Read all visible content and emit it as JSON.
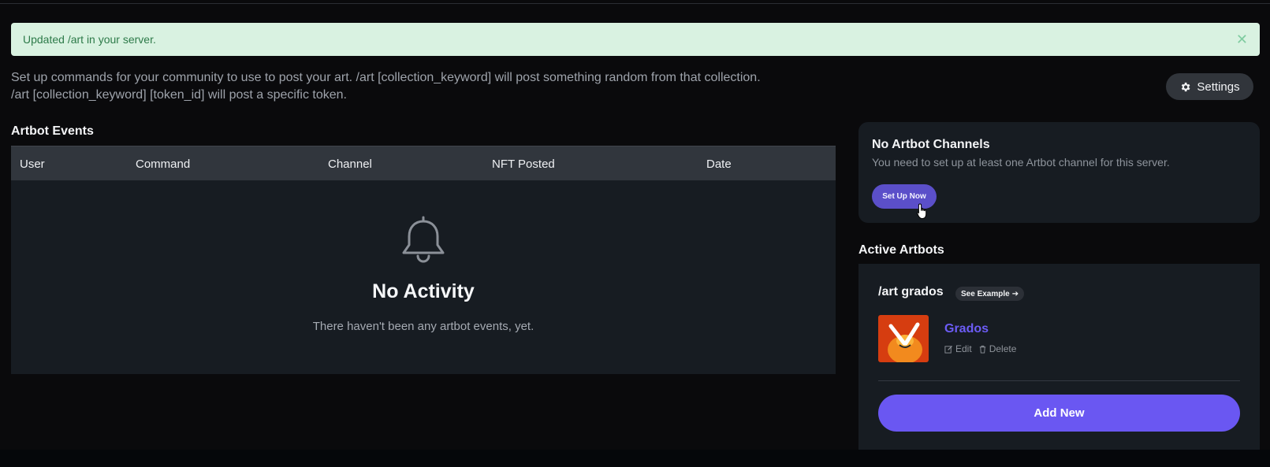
{
  "alert": {
    "message": "Updated /art in your server.",
    "close_glyph": "✕"
  },
  "intro": {
    "line1": "Set up commands for your community to use to post your art. /art [collection_keyword] will post something random from that collection.",
    "line2": "/art [collection_keyword] [token_id] will post a specific token."
  },
  "settings_button": {
    "label": "Settings",
    "icon": "gear-icon"
  },
  "events": {
    "title": "Artbot Events",
    "columns": [
      "User",
      "Command",
      "Channel",
      "NFT Posted",
      "Date"
    ],
    "empty_title": "No Activity",
    "empty_message": "There haven't been any artbot events, yet.",
    "empty_icon": "bell-icon"
  },
  "channels": {
    "title": "No Artbot Channels",
    "description": "You need to set up at least one Artbot channel for this server.",
    "button_label": "Set Up Now"
  },
  "active_artbots": {
    "title": "Active Artbots",
    "command": "/art grados",
    "example_label": "See Example",
    "example_arrow": "➔",
    "collection_name": "Grados",
    "edit_label": "Edit",
    "delete_label": "Delete",
    "add_label": "Add New"
  },
  "colors": {
    "alert_bg": "#d9f2e1",
    "alert_text": "#2d7a49",
    "accent": "#6a57f2",
    "panel": "#171c22",
    "page_bg": "#0a0a0c"
  }
}
